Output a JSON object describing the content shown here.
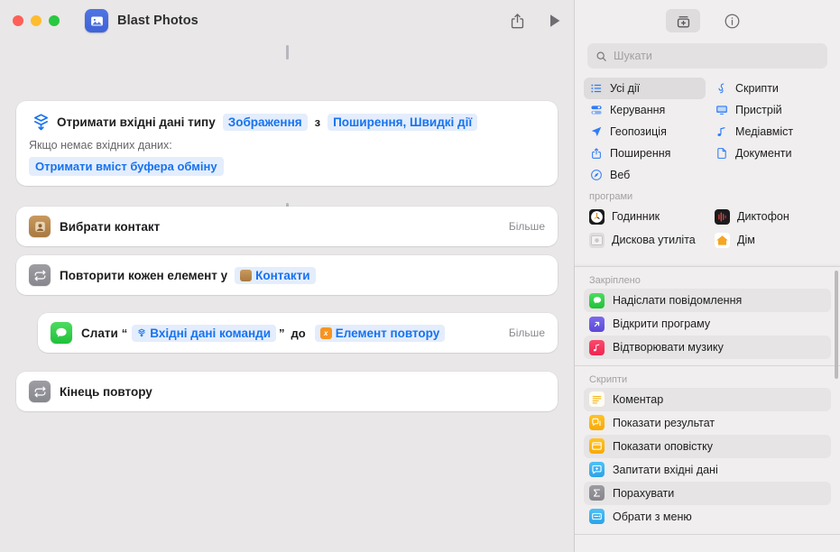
{
  "window": {
    "title": "Blast Photos",
    "app_icon": "photos-icon",
    "traffic_lights": [
      "close",
      "minimize",
      "zoom"
    ],
    "share_button": "share-icon",
    "run_button": "run-icon"
  },
  "editor": {
    "actions": [
      {
        "id": "receive-input",
        "icon": "shortcut-input-icon",
        "prefix": "Отримати вхідні дані типу",
        "token_type": "Зображення",
        "connector": "з",
        "token_source": "Поширення, Швидкі дії",
        "subtitle": "Якщо немає вхідних даних:",
        "fallback_chip": "Отримати вміст буфера обміну"
      },
      {
        "id": "select-contact",
        "icon": "contacts-icon",
        "label": "Вибрати контакт",
        "more": "Більше"
      },
      {
        "id": "repeat-each",
        "icon": "repeat-icon",
        "label": "Повторити кожен елемент у",
        "token": "Контакти",
        "token_icon": "contacts-token-icon"
      },
      {
        "id": "send-message",
        "icon": "messages-icon",
        "label": "Слати",
        "quote_open": "“",
        "token_input": "Вхідні дані команди",
        "token_input_icon": "shortcut-input-token-icon",
        "quote_close": "”",
        "connector": "до",
        "token_target": "Елемент повтору",
        "token_target_icon": "variable-icon",
        "more": "Більше"
      },
      {
        "id": "end-repeat",
        "icon": "repeat-icon",
        "label": "Кінець повтору"
      }
    ]
  },
  "sidebar": {
    "toolbar": {
      "library_button": "action-library-icon",
      "info_button": "info-icon"
    },
    "search": {
      "placeholder": "Шукати",
      "value": "",
      "icon": "search-icon"
    },
    "categories": [
      {
        "label": "Усі дії",
        "icon": "list-icon",
        "selected": true,
        "color": "#2f7cf6"
      },
      {
        "label": "Скрипти",
        "icon": "scripting-icon",
        "selected": false,
        "color": "#2f7cf6"
      },
      {
        "label": "Керування",
        "icon": "controls-icon",
        "selected": false,
        "color": "#2f7cf6"
      },
      {
        "label": "Пристрій",
        "icon": "device-icon",
        "selected": false,
        "color": "#2f7cf6"
      },
      {
        "label": "Геопозиція",
        "icon": "location-icon",
        "selected": false,
        "color": "#2f7cf6"
      },
      {
        "label": "Медіавміст",
        "icon": "media-icon",
        "selected": false,
        "color": "#2f7cf6"
      },
      {
        "label": "Поширення",
        "icon": "share-icon",
        "selected": false,
        "color": "#2f7cf6"
      },
      {
        "label": "Документи",
        "icon": "document-icon",
        "selected": false,
        "color": "#2f7cf6"
      },
      {
        "label": "Веб",
        "icon": "web-icon",
        "selected": false,
        "color": "#2f7cf6"
      }
    ],
    "apps_header": "програми",
    "apps": [
      {
        "label": "Годинник",
        "icon": "clock-app-icon",
        "color": "#1c1c1e"
      },
      {
        "label": "Диктофон",
        "icon": "voicememos-app-icon",
        "color": "#1c1c1e"
      },
      {
        "label": "Дискова утиліта",
        "icon": "diskutility-app-icon",
        "color": "#d8d6d6"
      },
      {
        "label": "Дім",
        "icon": "home-app-icon",
        "color": "#ffffff"
      }
    ],
    "pinned_header": "Закріплено",
    "pinned": [
      {
        "label": "Надіслати повідомлення",
        "icon": "messages-icon",
        "color": "#2ed04a",
        "alt": true
      },
      {
        "label": "Відкрити програму",
        "icon": "open-app-icon",
        "color": "#6a5ae0",
        "alt": false
      },
      {
        "label": "Відтворювати музику",
        "icon": "music-icon",
        "color": "#f5365c",
        "alt": true
      }
    ],
    "scripts_header": "Скрипти",
    "scripts": [
      {
        "label": "Коментар",
        "icon": "comment-icon",
        "color": "#fcfaf2",
        "alt": true
      },
      {
        "label": "Показати результат",
        "icon": "show-result-icon",
        "color": "#ffb90a",
        "alt": false
      },
      {
        "label": "Показати оповістку",
        "icon": "show-alert-icon",
        "color": "#ffb90a",
        "alt": true
      },
      {
        "label": "Запитати вхідні дані",
        "icon": "ask-input-icon",
        "color": "#39b3f0",
        "alt": false
      },
      {
        "label": "Порахувати",
        "icon": "calculate-icon",
        "color": "#8e8e93",
        "alt": true
      },
      {
        "label": "Обрати з меню",
        "icon": "choose-menu-icon",
        "color": "#39b3f0",
        "alt": false
      }
    ]
  },
  "colors": {
    "accent_blue": "#1673f0",
    "token_bg": "#e4edfc",
    "window_bg": "#e8e6e6",
    "sidebar_bg": "#f0eeee",
    "selection": "#dedcdc"
  }
}
